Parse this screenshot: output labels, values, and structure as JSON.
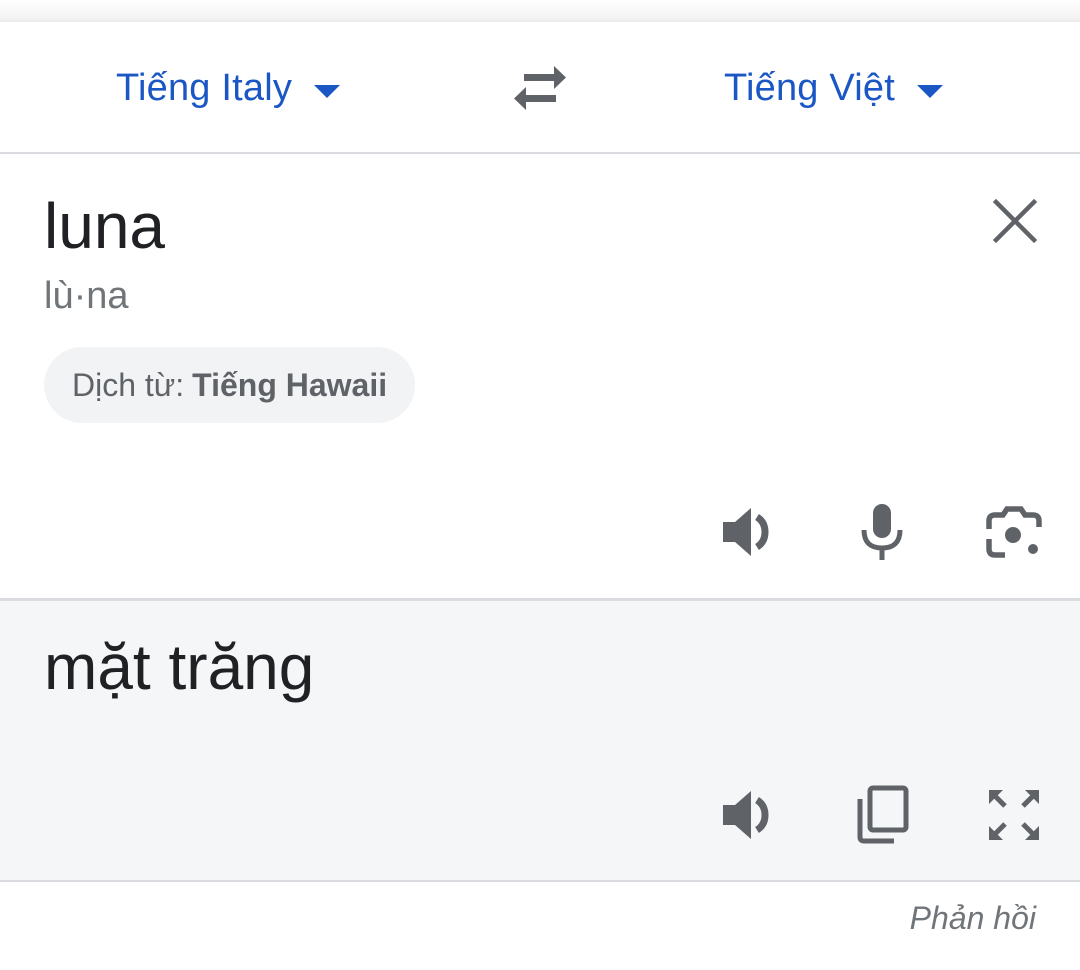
{
  "language_bar": {
    "source_language": "Tiếng Italy",
    "target_language": "Tiếng Việt",
    "swap_icon": "swap-arrows-icon",
    "caret_icon": "caret-down-icon"
  },
  "input": {
    "text": "luna",
    "phonetic": "lù·na",
    "detected_prefix": "Dịch từ:",
    "detected_language": "Tiếng Hawaii",
    "actions": [
      "speaker-icon",
      "microphone-icon",
      "camera-icon"
    ]
  },
  "output": {
    "text": "mặt trăng",
    "actions": [
      "speaker-icon",
      "copy-icon",
      "fullscreen-icon"
    ]
  },
  "footer": {
    "feedback_label": "Phản hồi"
  },
  "colors": {
    "accent": "#1a56c4",
    "icon": "#5f6368",
    "output_bg": "#f5f6f8",
    "chip_bg": "#f1f3f4"
  }
}
